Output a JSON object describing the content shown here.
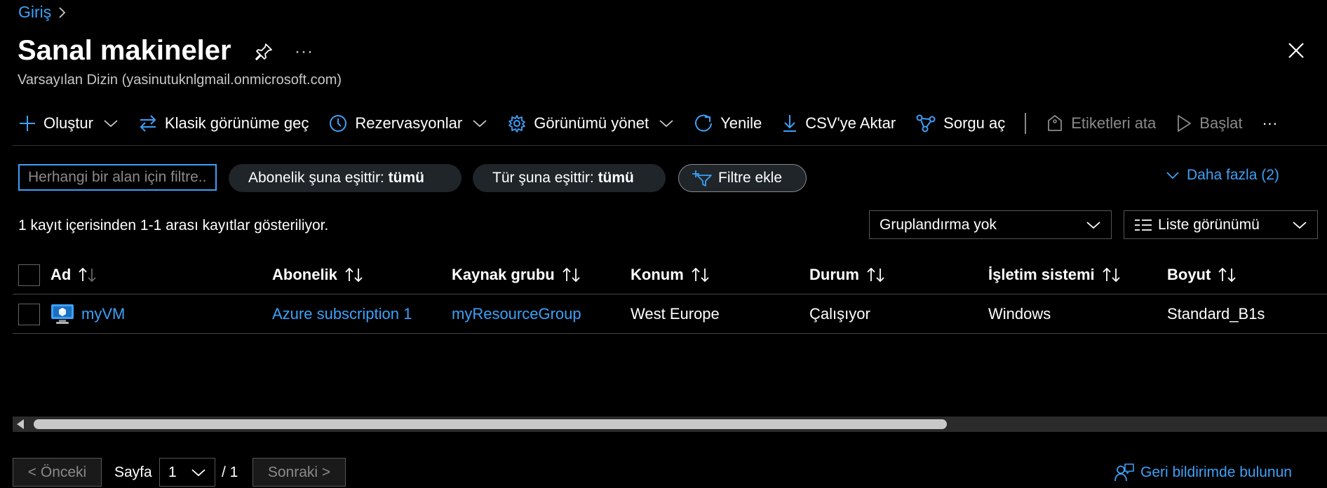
{
  "breadcrumb": {
    "home": "Giriş"
  },
  "header": {
    "title": "Sanal makineler",
    "subtitle": "Varsayılan Dizin (yasinutuknlgmail.onmicrosoft.com)",
    "more": "···"
  },
  "toolbar": {
    "create": "Oluştur",
    "classic": "Klasik görünüme geç",
    "reservations": "Rezervasyonlar",
    "manage_view": "Görünümü yönet",
    "refresh": "Yenile",
    "export_csv": "CSV'ye Aktar",
    "open_query": "Sorgu aç",
    "assign_tags": "Etiketleri ata",
    "start": "Başlat",
    "more": "···"
  },
  "filters": {
    "search_placeholder": "Herhangi bir alan için filtre...",
    "subscription_label": "Abonelik şuna eşittir: ",
    "subscription_value": "tümü",
    "type_label": "Tür şuna eşittir: ",
    "type_value": "tümü",
    "add_filter": "Filtre ekle",
    "more": "Daha fazla (2)"
  },
  "info": {
    "record_count": "1 kayıt içerisinden 1-1 arası kayıtlar gösteriliyor.",
    "grouping": "Gruplandırma yok",
    "view_mode": "Liste görünümü"
  },
  "table": {
    "columns": {
      "name": "Ad",
      "subscription": "Abonelik",
      "resource_group": "Kaynak grubu",
      "location": "Konum",
      "status": "Durum",
      "os": "İşletim sistemi",
      "size": "Boyut"
    },
    "rows": [
      {
        "name": "myVM",
        "subscription": "Azure subscription 1",
        "resource_group": "myResourceGroup",
        "location": "West Europe",
        "status": "Çalışıyor",
        "os": "Windows",
        "size": "Standard_B1s"
      }
    ]
  },
  "pagination": {
    "prev": "< Önceki",
    "page_label": "Sayfa",
    "current_page": "1",
    "total": "/ 1",
    "next": "Sonraki >"
  },
  "feedback": "Geri bildirimde bulunun",
  "colors": {
    "accent": "#3ea0f7",
    "background": "#000000",
    "pill": "#1f2529"
  }
}
